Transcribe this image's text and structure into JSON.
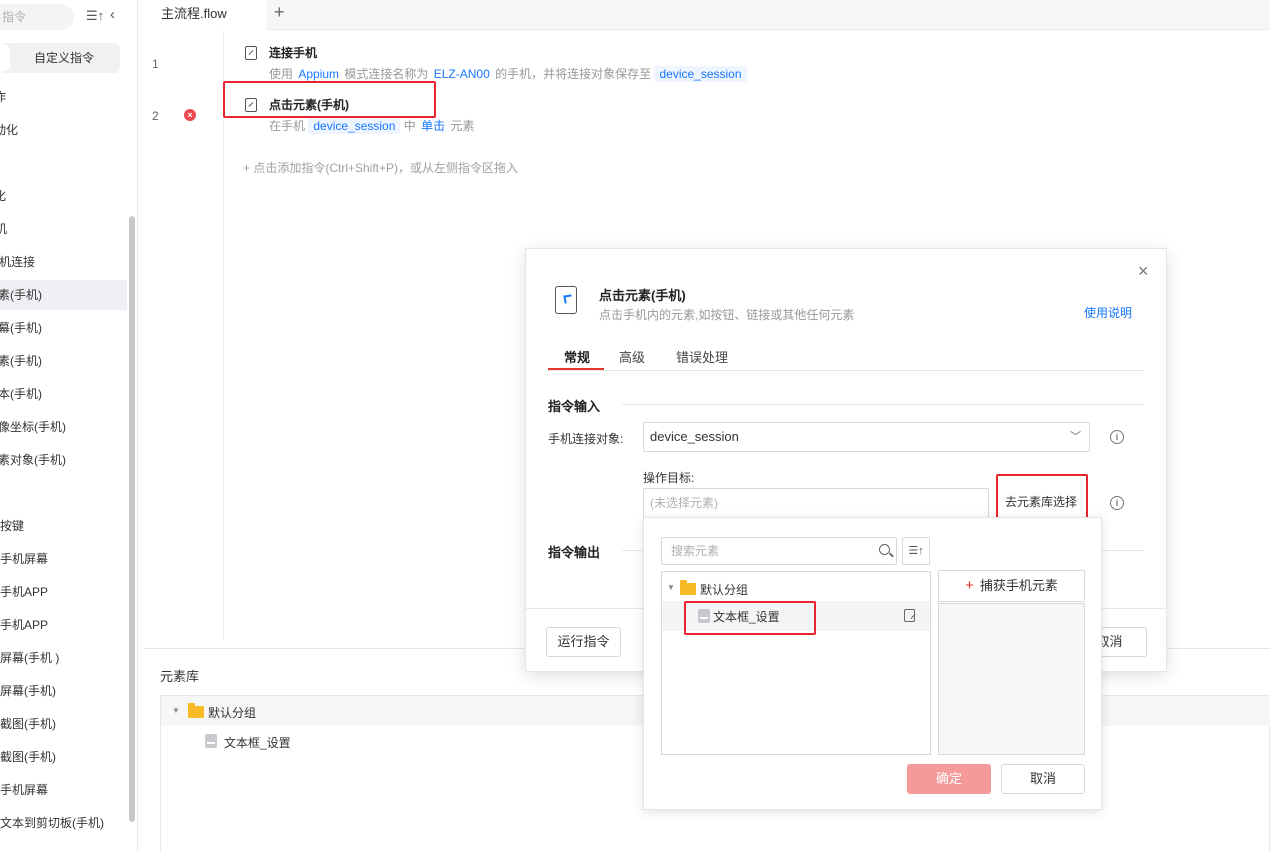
{
  "sidebar": {
    "search_placeholder": "指令",
    "sort_icon": "sort-icon",
    "collapse_icon": "chevron-left-icon",
    "custom_tab": "自定义指令",
    "items": [
      "作",
      "动化",
      "化",
      "机",
      "机连接",
      "素(手机)",
      "幕(手机)",
      "素(手机)",
      "本(手机)",
      "像坐标(手机)",
      "素对象(手机)",
      "按键",
      "手机屏幕",
      "手机APP",
      "手机APP",
      "屏幕(手机 )",
      "屏幕(手机)",
      "截图(手机)",
      "截图(手机)",
      "手机屏幕",
      "文本到剪切板(手机)"
    ]
  },
  "editor": {
    "tab": "主流程.flow",
    "add_tab": "+",
    "steps": [
      {
        "no": "1",
        "title": "连接手机",
        "desc": {
          "p1": "使用",
          "mode": "Appium",
          "p2": "模式连接名称为",
          "device": "ELZ-AN00",
          "p3": "的手机，并将连接对象保存至",
          "var": "device_session"
        }
      },
      {
        "no": "2",
        "title": "点击元素(手机)",
        "desc": {
          "p1": "在手机",
          "var": "device_session",
          "p2": "中",
          "action": "单击",
          "p3": "元素"
        }
      }
    ],
    "add_hint": "+ 点击添加指令(Ctrl+Shift+P)，或从左侧指令区拖入"
  },
  "library": {
    "title": "元素库",
    "group": "默认分组",
    "element": "文本框_设置"
  },
  "modal": {
    "title": "点击元素(手机)",
    "subtitle": "点击手机内的元素,如按钮、链接或其他任何元素",
    "help": "使用说明",
    "tabs": [
      "常规",
      "高级",
      "错误处理"
    ],
    "input_section": "指令输入",
    "device_label": "手机连接对象:",
    "device_value": "device_session",
    "target_label": "操作目标:",
    "target_placeholder": "(未选择元素)",
    "lib_select": "去元素库选择",
    "output_section": "指令输出",
    "run_btn": "运行指令",
    "cancel_btn": "取消"
  },
  "picker": {
    "search_placeholder": "搜索元素",
    "group": "默认分组",
    "element": "文本框_设置",
    "capture": "捕获手机元素",
    "ok": "确定",
    "cancel": "取消"
  },
  "colors": {
    "accent_blue": "#1677ff",
    "highlight_red": "#e8242e",
    "ok_disabled": "#f59a9a",
    "error": "#f0484f"
  }
}
